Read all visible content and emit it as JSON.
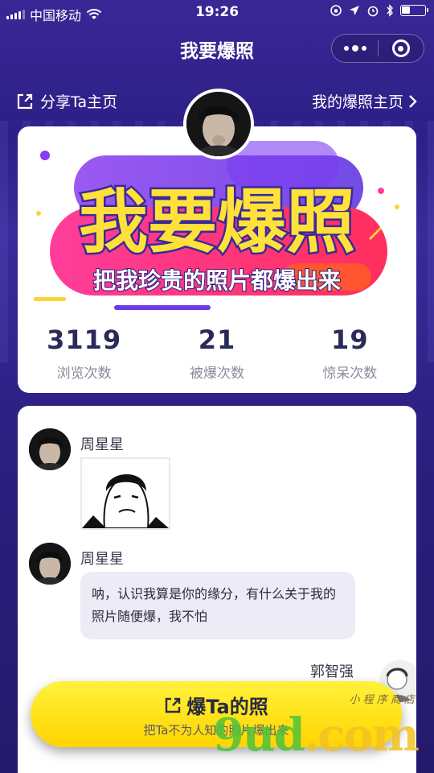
{
  "status_bar": {
    "carrier": "中国移动",
    "time": "19:26"
  },
  "nav": {
    "title": "我要爆照"
  },
  "links": {
    "share": "分享Ta主页",
    "mine": "我的爆照主页"
  },
  "banner": {
    "headline": "我要爆照",
    "tagline": "把我珍贵的照片都爆出来"
  },
  "stats": [
    {
      "value": "3119",
      "label": "浏览次数"
    },
    {
      "value": "21",
      "label": "被爆次数"
    },
    {
      "value": "19",
      "label": "惊呆次数"
    }
  ],
  "feed": [
    {
      "name": "周星星",
      "type": "image"
    },
    {
      "name": "周星星",
      "type": "text",
      "text": "呐，认识我算是你的缘分，有什么关于我的照片随便爆，我不怕"
    },
    {
      "name": "郭智强",
      "type": "image"
    }
  ],
  "cta": {
    "label": "爆Ta的照",
    "sub": "把Ta不为人知的照片爆出来"
  },
  "watermark": {
    "big_a": "9",
    "big_b": "ud",
    "big_c": ".com",
    "small": "小 程 序 商 店"
  },
  "colors": {
    "background": "#2c1f86",
    "cta": "#ffe21a",
    "banner_pink": "#ff2a8c",
    "banner_yellow": "#ffe13a"
  }
}
